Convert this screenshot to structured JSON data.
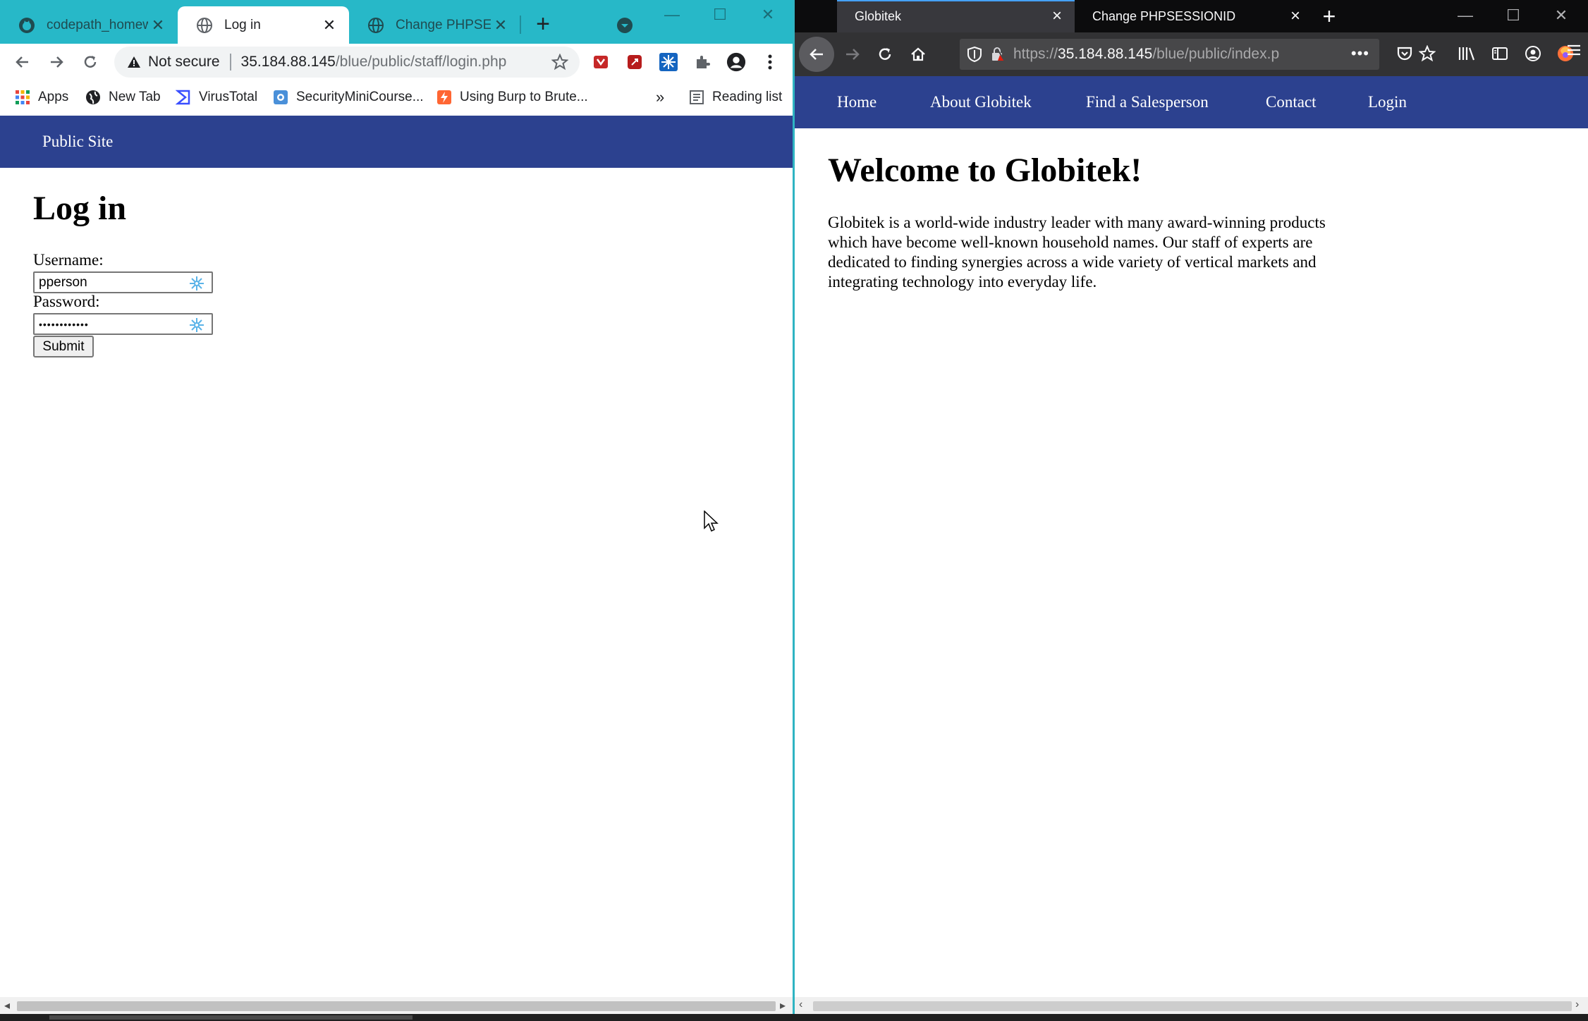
{
  "chrome": {
    "tabs": [
      {
        "title": "codepath_homew"
      },
      {
        "title": "Log in"
      },
      {
        "title": "Change PHPSESSI"
      }
    ],
    "omnibox": {
      "security_text": "Not secure",
      "host": "35.184.88.145",
      "path": "/blue/public/staff/login.php"
    },
    "bookmarks": [
      {
        "label": "Apps"
      },
      {
        "label": "New Tab"
      },
      {
        "label": "VirusTotal"
      },
      {
        "label": "SecurityMiniCourse..."
      },
      {
        "label": "Using Burp to Brute..."
      }
    ],
    "bookmarks_overflow": "»",
    "reading_list": "Reading list",
    "page": {
      "nav_link": "Public Site",
      "heading": "Log in",
      "username_label": "Username:",
      "username_value": "pperson",
      "password_label": "Password:",
      "password_value": "••••••••••••",
      "submit_label": "Submit"
    }
  },
  "firefox": {
    "tabs": [
      {
        "title": "Globitek"
      },
      {
        "title": "Change PHPSESSIONID"
      }
    ],
    "url": {
      "scheme": "https://",
      "host": "35.184.88.145",
      "path": "/blue/public/index.p"
    },
    "page": {
      "nav": [
        "Home",
        "About Globitek",
        "Find a Salesperson",
        "Contact",
        "Login"
      ],
      "heading": "Welcome to Globitek!",
      "intro": "Globitek is a world-wide industry leader with many award-winning products which have become well-known household names. Our staff of experts are dedicated to finding synergies across a wide variety of vertical markets and integrating technology into everyday life."
    }
  },
  "colors": {
    "chrome_tabstrip": "#27b8c8",
    "site_nav": "#2c418f",
    "firefox_dark": "#0c0c0d",
    "firefox_toolbar": "#323234"
  }
}
